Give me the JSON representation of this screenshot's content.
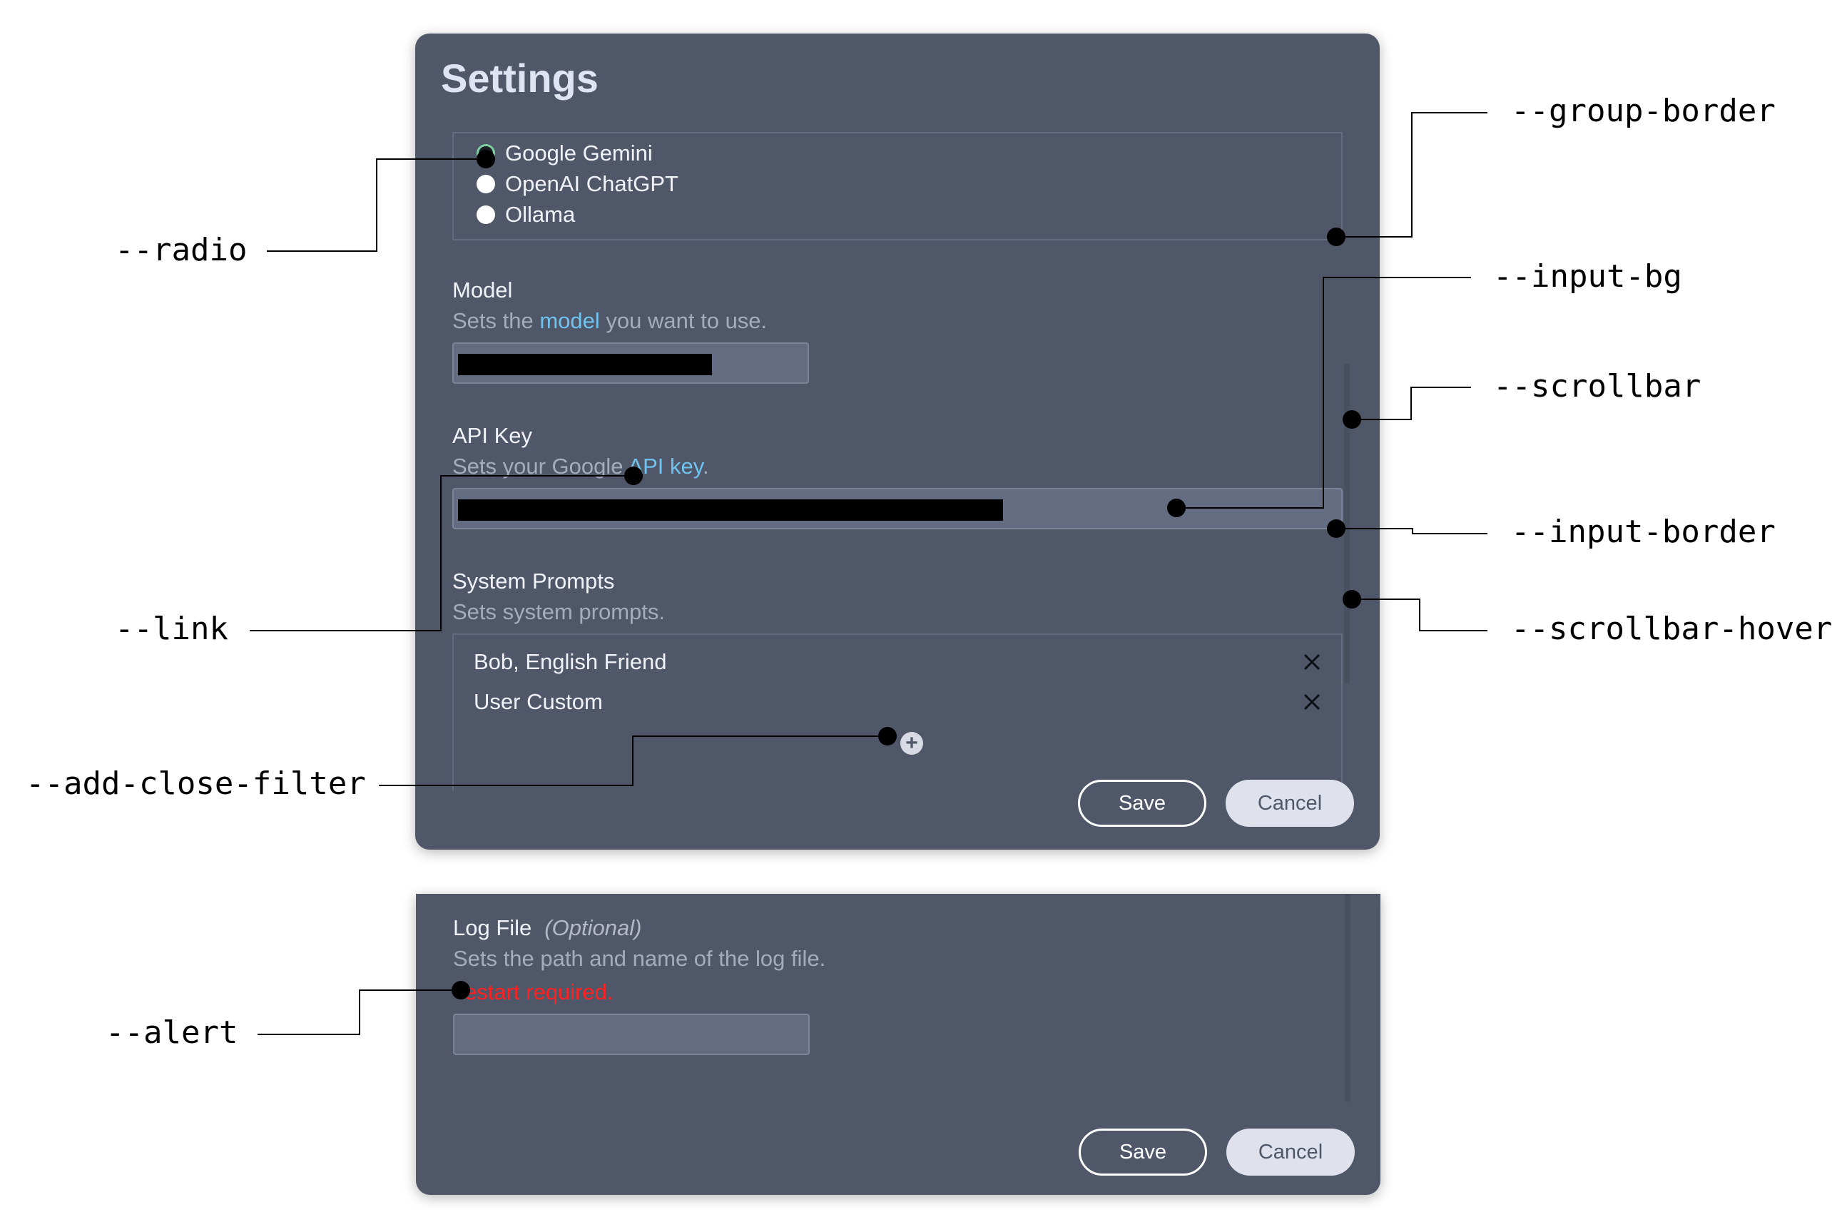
{
  "dialog": {
    "title": "Settings",
    "providers": [
      {
        "label": "Google Gemini",
        "selected": true
      },
      {
        "label": "OpenAI ChatGPT",
        "selected": false
      },
      {
        "label": "Ollama",
        "selected": false
      }
    ],
    "model": {
      "label": "Model",
      "desc_before": "Sets the ",
      "desc_link": "model",
      "desc_after": " you want to use."
    },
    "api_key": {
      "label": "API Key",
      "desc_before": "Sets your Google ",
      "desc_link": "API key",
      "desc_after": "."
    },
    "system_prompts": {
      "label": "System Prompts",
      "desc": "Sets system prompts.",
      "items": [
        "Bob, English Friend",
        "User Custom"
      ]
    },
    "save_label": "Save",
    "cancel_label": "Cancel"
  },
  "dialog_bottom": {
    "log_file": {
      "label": "Log File",
      "optional": "(Optional)",
      "desc": "Sets the path and name of the log file.",
      "alert": "estart required."
    },
    "save_label": "Save",
    "cancel_label": "Cancel"
  },
  "annotations": {
    "group_border": "--group-border",
    "radio": "--radio",
    "input_bg": "--input-bg",
    "scrollbar": "--scrollbar",
    "input_border": "--input-border",
    "link": "--link",
    "scrollbar_hover": "--scrollbar-hover",
    "add_close_filter": "--add-close-filter",
    "alert": "--alert"
  },
  "colors": {
    "panel_bg": "#4f5769",
    "title": "#dfe4f3",
    "link": "#6fc3ee",
    "alert": "#ff2020",
    "input_bg": "#646c82",
    "input_border": "#7c8497",
    "group_border": "#636c80",
    "radio_checked_ring": "#7fcfa0",
    "cancel_bg": "#dfe2ec"
  }
}
